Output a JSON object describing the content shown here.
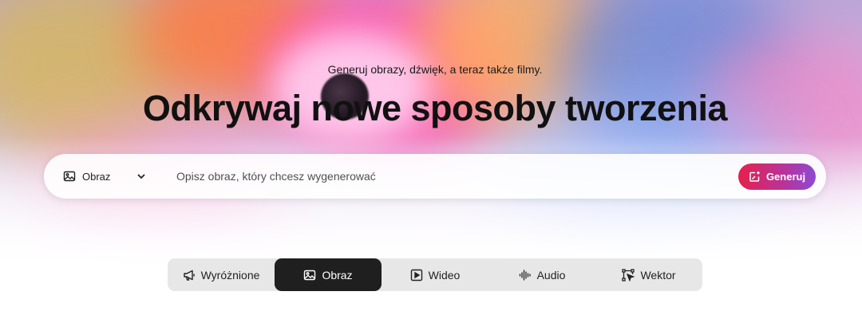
{
  "hero": {
    "subtitle": "Generuj obrazy, dźwięk, a teraz także filmy.",
    "title": "Odkrywaj nowe sposoby tworzenia"
  },
  "prompt_bar": {
    "type_selector": {
      "selected": "Obraz",
      "icon": "image-icon",
      "dropdown_icon": "chevron-down-icon"
    },
    "input": {
      "placeholder": "Opisz obraz, który chcesz wygenerować",
      "value": ""
    },
    "generate_button": {
      "label": "Generuj",
      "icon": "generate-icon"
    }
  },
  "tabs": [
    {
      "label": "Wyróżnione",
      "icon": "megaphone-icon",
      "active": false
    },
    {
      "label": "Obraz",
      "icon": "image-icon",
      "active": true
    },
    {
      "label": "Wideo",
      "icon": "play-icon",
      "active": false
    },
    {
      "label": "Audio",
      "icon": "waveform-icon",
      "active": false
    },
    {
      "label": "Wektor",
      "icon": "vector-icon",
      "active": false
    }
  ],
  "colors": {
    "accent_gradient_start": "#e5204d",
    "accent_gradient_end": "#8d4ad3",
    "active_tab_bg": "#1f1f1f",
    "tab_bar_bg": "#e7e7e7"
  }
}
